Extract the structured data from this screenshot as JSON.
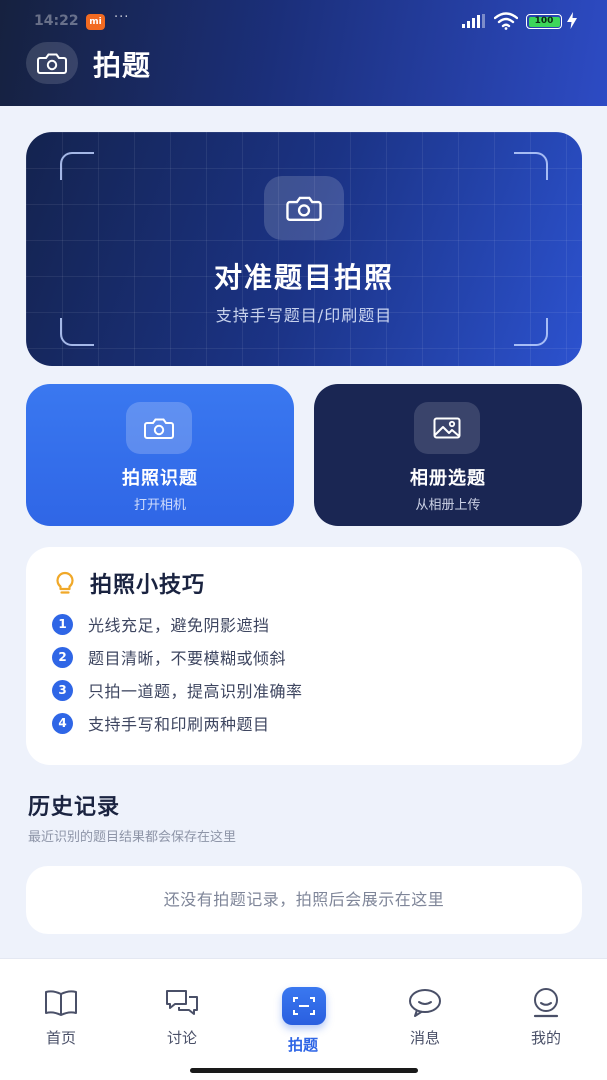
{
  "status_bar": {
    "time": "14:22",
    "carrier_badge": "mi",
    "dots": "···",
    "battery_level": "100"
  },
  "header": {
    "title": "拍题",
    "icon": "camera-icon"
  },
  "hero": {
    "title": "对准题目拍照",
    "subtitle": "支持手写题目/印刷题目",
    "icon": "camera-icon"
  },
  "actions": [
    {
      "title": "拍照识题",
      "subtitle": "打开相机",
      "icon": "camera-icon",
      "color": "#2f66e6"
    },
    {
      "title": "相册选题",
      "subtitle": "从相册上传",
      "icon": "image-icon",
      "color": "#1a2653"
    }
  ],
  "tips": {
    "title": "拍照小技巧",
    "icon": "lightbulb-icon",
    "items": [
      {
        "num": "1",
        "text": "光线充足，避免阴影遮挡"
      },
      {
        "num": "2",
        "text": "题目清晰，不要模糊或倾斜"
      },
      {
        "num": "3",
        "text": "只拍一道题，提高识别准确率"
      },
      {
        "num": "4",
        "text": "支持手写和印刷两种题目"
      }
    ]
  },
  "history": {
    "title": "历史记录",
    "subtitle": "最近识别的题目结果都会保存在这里",
    "empty_text": "还没有拍题记录，拍照后会展示在这里"
  },
  "nav": {
    "items": [
      {
        "label": "首页",
        "icon": "book-icon"
      },
      {
        "label": "讨论",
        "icon": "chat-bubbles-icon"
      },
      {
        "label": "拍题",
        "icon": "scan-icon",
        "active": true
      },
      {
        "label": "消息",
        "icon": "message-icon"
      },
      {
        "label": "我的",
        "icon": "profile-icon"
      }
    ]
  },
  "colors": {
    "primary": "#2f66e6",
    "dark_navy": "#1a2653",
    "background": "#eef2fb",
    "tip_bulb": "#f0a828"
  }
}
